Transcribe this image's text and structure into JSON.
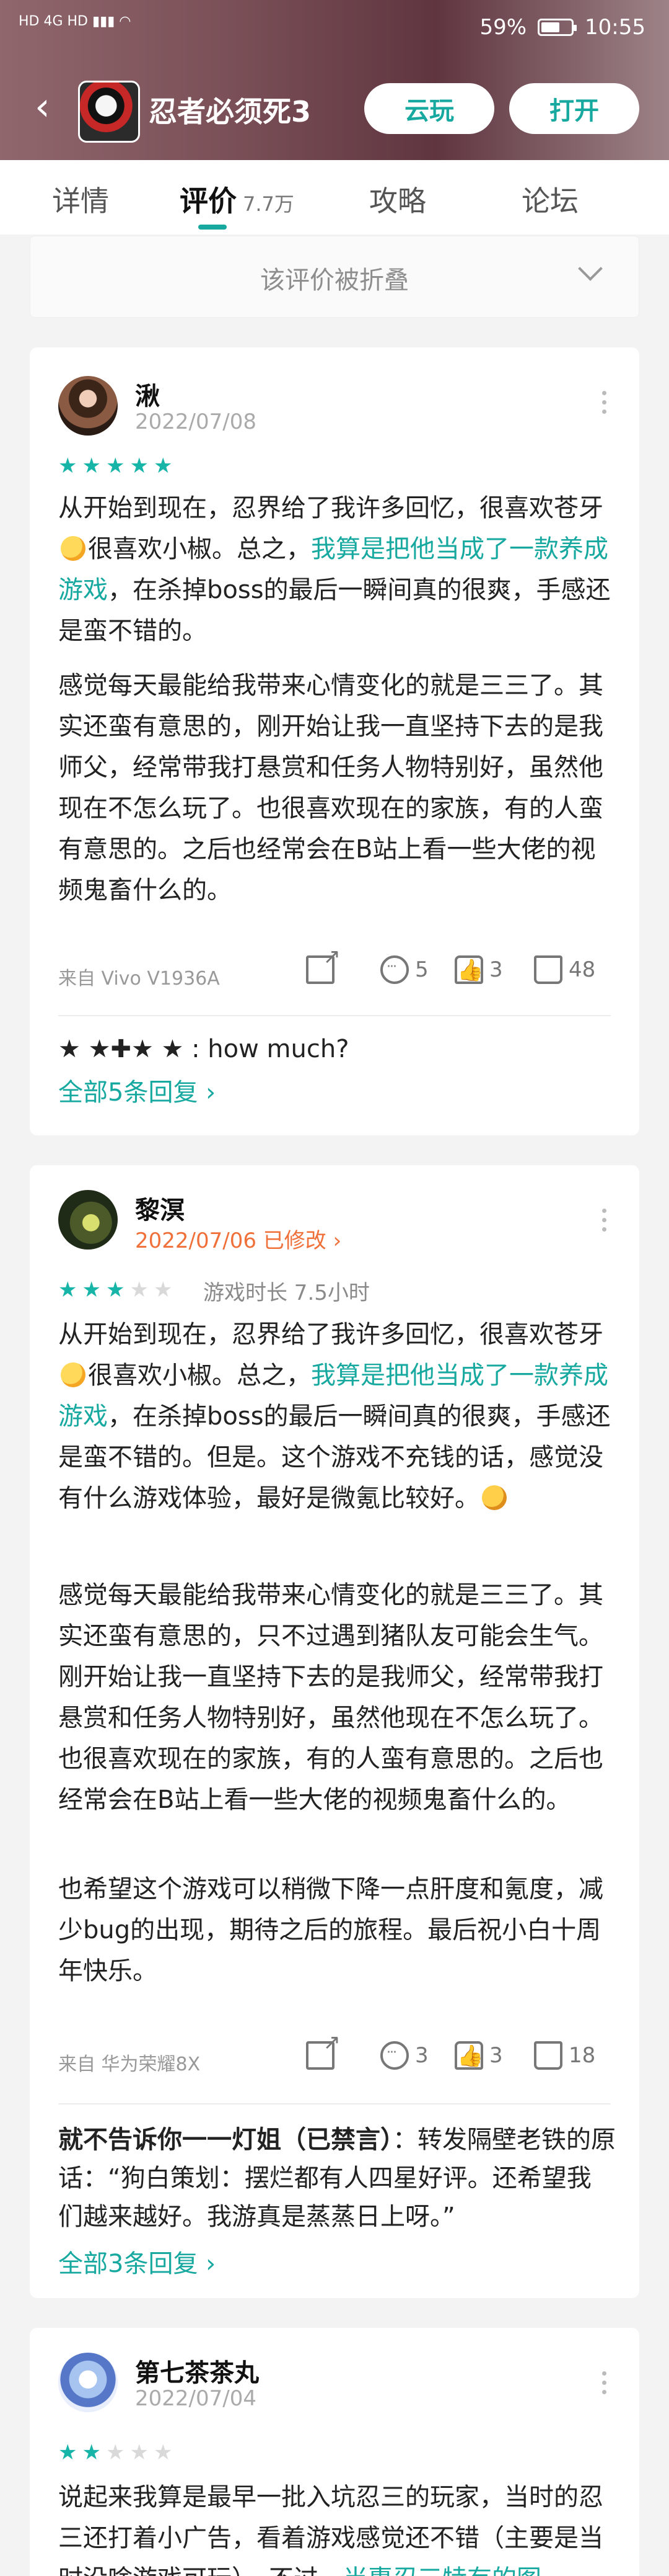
{
  "status_bar": {
    "left": "HD 4G HD ▮▮▮ ◠",
    "battery": "59%",
    "time": "10:55"
  },
  "nav": {
    "title": "忍者必须死3",
    "cloud_play": "云玩",
    "open": "打开"
  },
  "tabs": [
    {
      "label": "详情"
    },
    {
      "label": "评价",
      "count": "7.7万"
    },
    {
      "label": "攻略"
    },
    {
      "label": "论坛"
    }
  ],
  "folded": {
    "text": "该评价被折叠"
  },
  "reviews": [
    {
      "username": "湫",
      "date": "2022/07/08",
      "p1_a": "从开始到现在，忍界给了我许多回忆，很喜欢苍牙",
      "p1_b": "很喜欢小椒。总之，",
      "p1_hl": "我算是把他当成了一款养成游戏",
      "p1_c": "，在杀掉boss的最后一瞬间真的很爽，手感还是蛮不错的。",
      "p2": "感觉每天最能给我带来心情变化的就是三三了。其实还蛮有意思的，刚开始让我一直坚持下去的是我师父，经常带我打悬赏和任务人物特别好，虽然他现在不怎么玩了。也很喜欢现在的家族，有的人蛮有意思的。之后也经常会在B站上看一些大佬的视频鬼畜什么的。",
      "device": "来自 Vivo V1936A",
      "comments": "5",
      "likes": "3",
      "dislikes": "48",
      "reply_text": "★ ★✚★ ★ : how much?",
      "reply_link": "全部5条回复 ›"
    },
    {
      "username": "黎溟",
      "date": "2022/07/06 已修改 ›",
      "playtime": "游戏时长 7.5小时",
      "p1_a": "从开始到现在，忍界给了我许多回忆，很喜欢苍牙",
      "p1_b": "很喜欢小椒。总之，",
      "p1_hl": "我算是把他当成了一款养成游戏",
      "p1_c": "，在杀掉boss的最后一瞬间真的很爽，手感还是蛮不错的。但是。这个游戏不充钱的话，感觉没有什么游戏体验，最好是微氪比较好。",
      "p2": "感觉每天最能给我带来心情变化的就是三三了。其实还蛮有意思的，只不过遇到猪队友可能会生气。刚开始让我一直坚持下去的是我师父，经常带我打悬赏和任务人物特别好，虽然他现在不怎么玩了。也很喜欢现在的家族，有的人蛮有意思的。之后也经常会在B站上看一些大佬的视频鬼畜什么的。",
      "p3": "也希望这个游戏可以稍微下降一点肝度和氪度，减少bug的出现，期待之后的旅程。最后祝小白十周年快乐。",
      "device": "来自 华为荣耀8X",
      "comments": "3",
      "likes": "3",
      "dislikes": "18",
      "reply_author": "就不告诉你一一灯姐（已禁言）",
      "reply_text": "：转发隔壁老铁的原话：“狗白策划：摆烂都有人四星好评。还希望我们越来越好。我游真是蒸蒸日上呀。”",
      "reply_link": "全部3条回复 ›"
    },
    {
      "username": "第七茶茶丸",
      "date": "2022/07/04",
      "p1_a": "说起来我算是最早一批入坑忍三的玩家，当时的忍三还打着小广告，看着游戏感觉还不错（主要是当时没啥游戏可玩）。不过，",
      "p1_hl": "当惠忍三特有的图"
    }
  ],
  "colors": {
    "accent": "#17a9a0",
    "star_on": "#17b4a8",
    "edited": "#f0703a"
  }
}
